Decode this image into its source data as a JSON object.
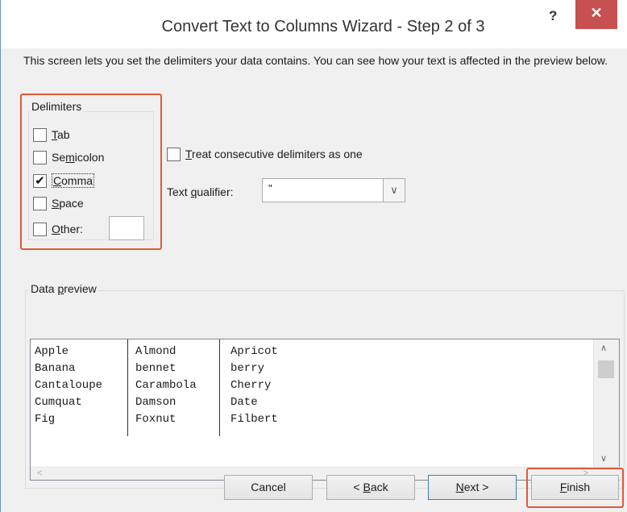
{
  "dialog": {
    "title": "Convert Text to Columns Wizard - Step 2 of 3",
    "help": "?",
    "close": "✕"
  },
  "description": "This screen lets you set the delimiters your data contains.  You can see how your text is affected in the preview below.",
  "delimiters": {
    "label": "Delimiters",
    "items": [
      {
        "label_pre": "",
        "label_u": "T",
        "label_post": "ab",
        "checked": false
      },
      {
        "label_pre": "Se",
        "label_u": "m",
        "label_post": "icolon",
        "checked": false
      },
      {
        "label_pre": "",
        "label_u": "C",
        "label_post": "omma",
        "checked": true
      },
      {
        "label_pre": "",
        "label_u": "S",
        "label_post": "pace",
        "checked": false
      },
      {
        "label_pre": "",
        "label_u": "O",
        "label_post": "ther:",
        "checked": false
      }
    ],
    "other_value": ""
  },
  "options": {
    "consecutive_pre": "",
    "consecutive_u": "T",
    "consecutive_post": "reat consecutive delimiters as one",
    "consecutive_checked": false,
    "qualifier_pre": "Text ",
    "qualifier_u": "q",
    "qualifier_post": "ualifier:",
    "qualifier_value": "\""
  },
  "preview": {
    "label_pre": "Data ",
    "label_u": "p",
    "label_post": "review",
    "rows": [
      [
        "Apple",
        "Almond",
        "Apricot"
      ],
      [
        "Banana",
        "bennet",
        "berry"
      ],
      [
        "Cantaloupe",
        "Carambola",
        "Cherry"
      ],
      [
        "Cumquat",
        "Damson",
        "Date"
      ],
      [
        "Fig",
        "Foxnut",
        "Filbert"
      ]
    ]
  },
  "buttons": {
    "cancel": "Cancel",
    "back_pre": "< ",
    "back_u": "B",
    "back_post": "ack",
    "next_pre": "",
    "next_u": "N",
    "next_post": "ext >",
    "finish_pre": "",
    "finish_u": "F",
    "finish_post": "inish"
  },
  "colors": {
    "highlight": "#e05a3a",
    "close_button": "#c75050",
    "window_border": "#6a95c9"
  }
}
